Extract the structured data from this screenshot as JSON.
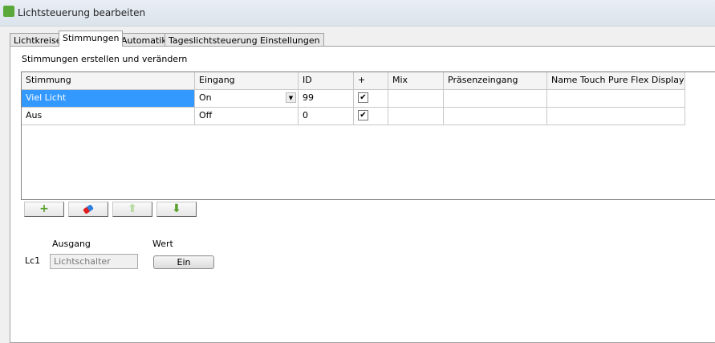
{
  "window": {
    "title": "Lichtsteuerung bearbeiten"
  },
  "tabs": [
    {
      "label": "Lichtkreise"
    },
    {
      "label": "Stimmungen"
    },
    {
      "label": "Automatik"
    },
    {
      "label": "Tageslichtsteuerung Einstellungen"
    }
  ],
  "section": {
    "label": "Stimmungen erstellen und verändern"
  },
  "grid": {
    "columns": [
      "Stimmung",
      "Eingang",
      "ID",
      "+",
      "Mix",
      "Präsenzeingang",
      "Name Touch Pure Flex Display"
    ],
    "rows": [
      {
        "stimmung": "Viel Licht",
        "eingang": "On",
        "id": "99",
        "plus": true,
        "mix": "",
        "praesenz": "",
        "name": ""
      },
      {
        "stimmung": "Aus",
        "eingang": "Off",
        "id": "0",
        "plus": true,
        "mix": "",
        "praesenz": "",
        "name": ""
      }
    ]
  },
  "toolbar": {
    "add": "+",
    "up": "⬆",
    "down": "⬇"
  },
  "output": {
    "row_label": "Lc1",
    "ausgang_label": "Ausgang",
    "wert_label": "Wert",
    "ausgang_value": "Lichtschalter",
    "wert_button": "Ein"
  }
}
